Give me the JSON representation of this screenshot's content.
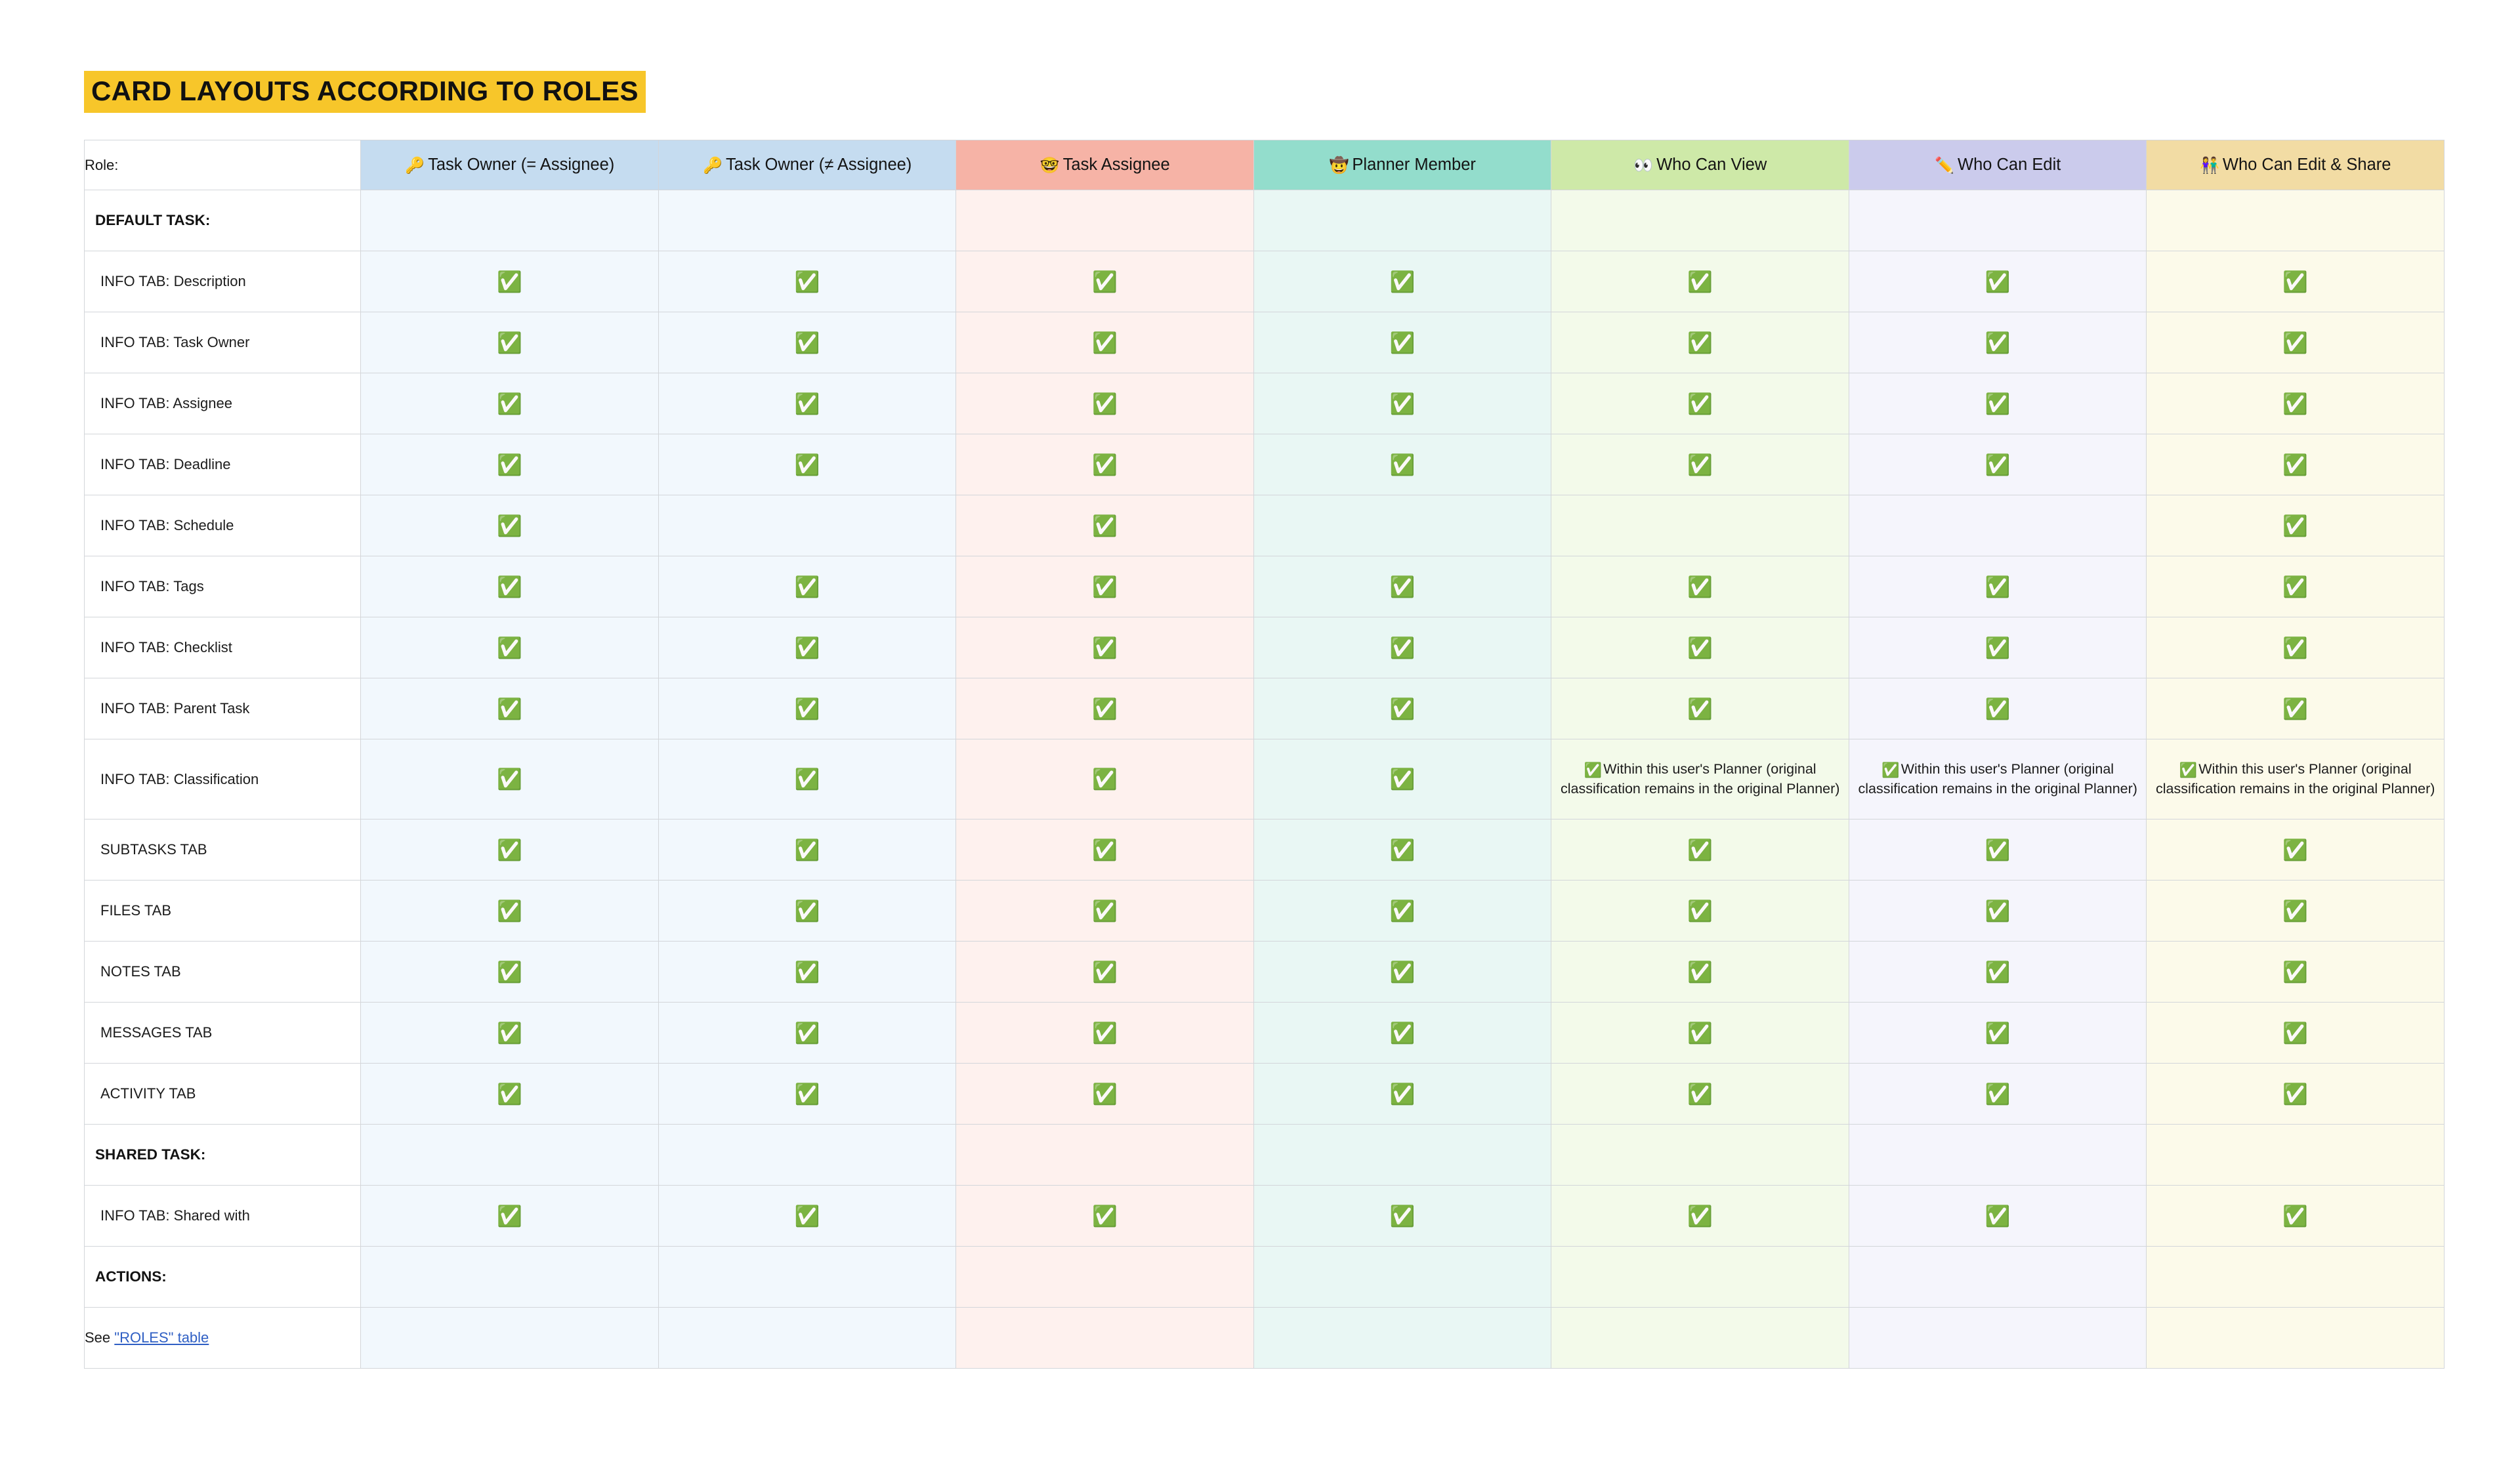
{
  "page": {
    "title": "CARD LAYOUTS ACCORDING TO ROLES",
    "title_highlight_color": "#f7c62a"
  },
  "table": {
    "role_header": "Role:",
    "columns": [
      {
        "label": "Task Owner (= Assignee)",
        "icon": "key-icon",
        "emoji": "🔑",
        "header_color": "#c5dcf0",
        "body_color": "#f2f8fd"
      },
      {
        "label": "Task Owner (≠ Assignee)",
        "icon": "key-icon",
        "emoji": "🔑",
        "header_color": "#c5dcf0",
        "body_color": "#f2f8fd"
      },
      {
        "label": "Task Assignee",
        "icon": "nerd-face-icon",
        "emoji": "🤓",
        "header_color": "#f6b3a6",
        "body_color": "#fef1ee"
      },
      {
        "label": "Planner Member",
        "icon": "cowboy-hat-face-icon",
        "emoji": "🤠",
        "header_color": "#93ddcc",
        "body_color": "#e9f7f4"
      },
      {
        "label": "Who Can View",
        "icon": "eyes-icon",
        "emoji": "👀",
        "header_color": "#cee9a8",
        "body_color": "#f3faea"
      },
      {
        "label": "Who Can Edit",
        "icon": "pencil-icon",
        "emoji": "✏️",
        "header_color": "#cbcbec",
        "body_color": "#f5f5fc"
      },
      {
        "label": "Who Can Edit & Share",
        "icon": "people-holding-hands-icon",
        "emoji": "👫",
        "header_color": "#f2dca4",
        "body_color": "#fcfaea"
      }
    ],
    "check_symbol": "✅",
    "classification_note": "✅ Within this user's Planner (original classification remains in the original Planner)",
    "classification_note_lines": [
      "Within this user's Planner",
      "(original classification remains",
      "in the original Planner)"
    ],
    "footer_see_text": "See ",
    "footer_link_text": "\"ROLES\" table",
    "rows": [
      {
        "label": "DEFAULT TASK:",
        "type": "section",
        "cells": [
          "",
          "",
          "",
          "",
          "",
          "",
          ""
        ]
      },
      {
        "label": "INFO TAB: Description",
        "type": "item",
        "cells": [
          "check",
          "check",
          "check",
          "check",
          "check",
          "check",
          "check"
        ]
      },
      {
        "label": "INFO TAB: Task Owner",
        "type": "item",
        "cells": [
          "check",
          "check",
          "check",
          "check",
          "check",
          "check",
          "check"
        ]
      },
      {
        "label": "INFO TAB: Assignee",
        "type": "item",
        "cells": [
          "check",
          "check",
          "check",
          "check",
          "check",
          "check",
          "check"
        ]
      },
      {
        "label": "INFO TAB: Deadline",
        "type": "item",
        "cells": [
          "check",
          "check",
          "check",
          "check",
          "check",
          "check",
          "check"
        ]
      },
      {
        "label": "INFO TAB: Schedule",
        "type": "item",
        "cells": [
          "check",
          "",
          "check",
          "",
          "",
          "",
          "check"
        ]
      },
      {
        "label": "INFO TAB: Tags",
        "type": "item",
        "cells": [
          "check",
          "check",
          "check",
          "check",
          "check",
          "check",
          "check"
        ]
      },
      {
        "label": "INFO TAB: Checklist",
        "type": "item",
        "cells": [
          "check",
          "check",
          "check",
          "check",
          "check",
          "check",
          "check"
        ]
      },
      {
        "label": "INFO TAB: Parent Task",
        "type": "item",
        "cells": [
          "check",
          "check",
          "check",
          "check",
          "check",
          "check",
          "check"
        ]
      },
      {
        "label": "INFO TAB: Classification",
        "type": "class",
        "cells": [
          "check",
          "check",
          "check",
          "check",
          "note",
          "note",
          "note"
        ]
      },
      {
        "label": "SUBTASKS TAB",
        "type": "item",
        "cells": [
          "check",
          "check",
          "check",
          "check",
          "check",
          "check",
          "check"
        ]
      },
      {
        "label": "FILES TAB",
        "type": "item",
        "cells": [
          "check",
          "check",
          "check",
          "check",
          "check",
          "check",
          "check"
        ]
      },
      {
        "label": "NOTES TAB",
        "type": "item",
        "cells": [
          "check",
          "check",
          "check",
          "check",
          "check",
          "check",
          "check"
        ]
      },
      {
        "label": "MESSAGES TAB",
        "type": "item",
        "cells": [
          "check",
          "check",
          "check",
          "check",
          "check",
          "check",
          "check"
        ]
      },
      {
        "label": "ACTIVITY TAB",
        "type": "item",
        "cells": [
          "check",
          "check",
          "check",
          "check",
          "check",
          "check",
          "check"
        ]
      },
      {
        "label": "SHARED TASK:",
        "type": "section",
        "cells": [
          "",
          "",
          "",
          "",
          "",
          "",
          ""
        ]
      },
      {
        "label": "INFO TAB: Shared with",
        "type": "item",
        "cells": [
          "check",
          "check",
          "check",
          "check",
          "check",
          "check",
          "check"
        ]
      },
      {
        "label": "ACTIONS:",
        "type": "section",
        "cells": [
          "",
          "",
          "",
          "",
          "",
          "",
          ""
        ]
      },
      {
        "label": "",
        "type": "footer",
        "cells": [
          "",
          "",
          "",
          "",
          "",
          "",
          ""
        ]
      }
    ]
  }
}
